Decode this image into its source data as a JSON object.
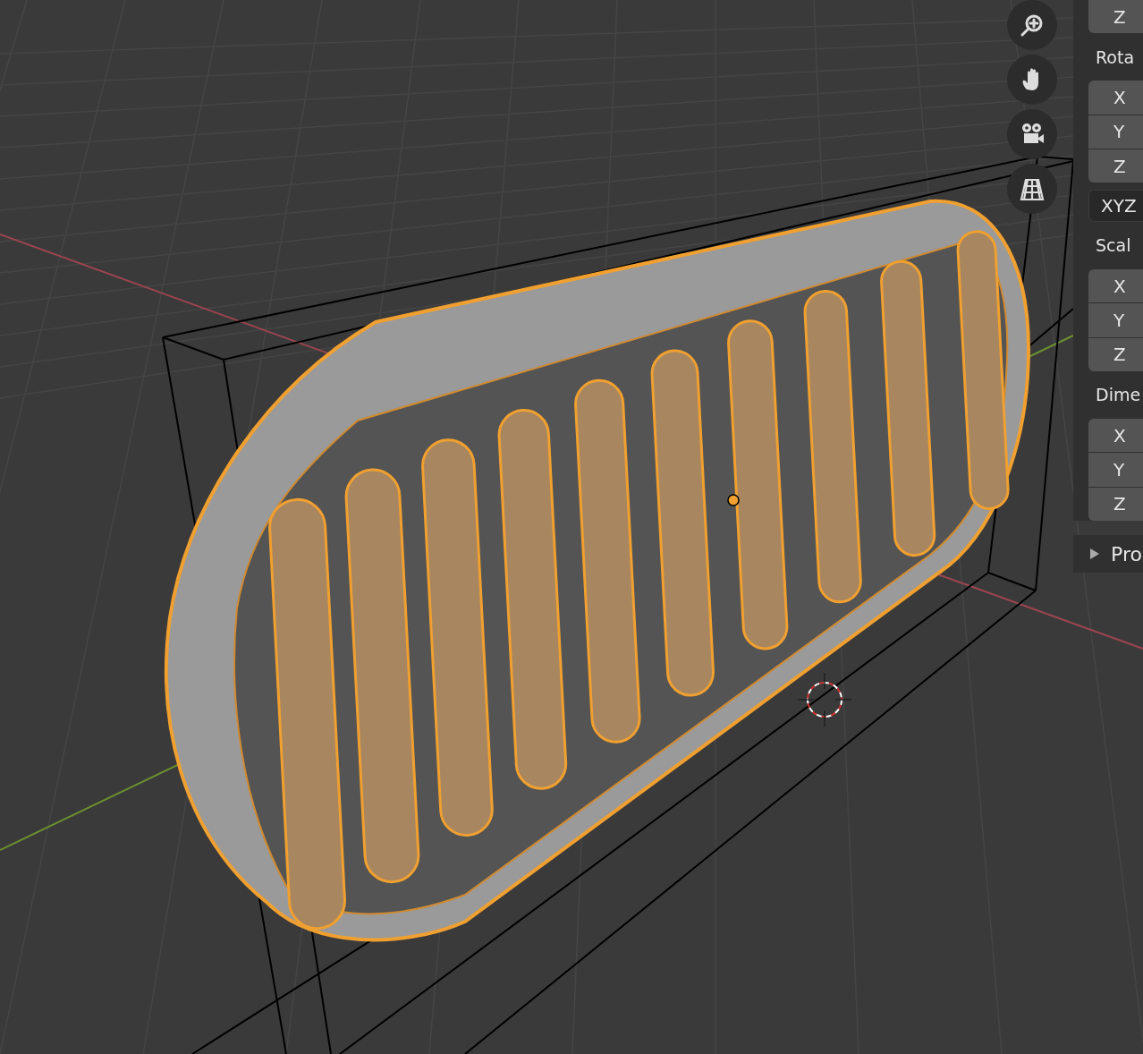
{
  "viewport": {
    "navigation_buttons": [
      {
        "kind": "zoom"
      },
      {
        "kind": "pan"
      },
      {
        "kind": "camera"
      },
      {
        "kind": "perspective"
      }
    ]
  },
  "sidebar": {
    "sections": [
      {
        "kind": "fields",
        "fields": [
          "Z"
        ]
      },
      {
        "kind": "label",
        "text": "Rota"
      },
      {
        "kind": "fields",
        "fields": [
          "X",
          "Y",
          "Z"
        ]
      },
      {
        "kind": "dropdown",
        "text": "XYZ"
      },
      {
        "kind": "label",
        "text": "Scal"
      },
      {
        "kind": "fields",
        "fields": [
          "X",
          "Y",
          "Z"
        ]
      },
      {
        "kind": "label",
        "text": "Dime"
      },
      {
        "kind": "fields",
        "fields": [
          "X",
          "Y",
          "Z"
        ]
      }
    ],
    "subpanel": {
      "title": "Pro",
      "expanded": false
    }
  }
}
